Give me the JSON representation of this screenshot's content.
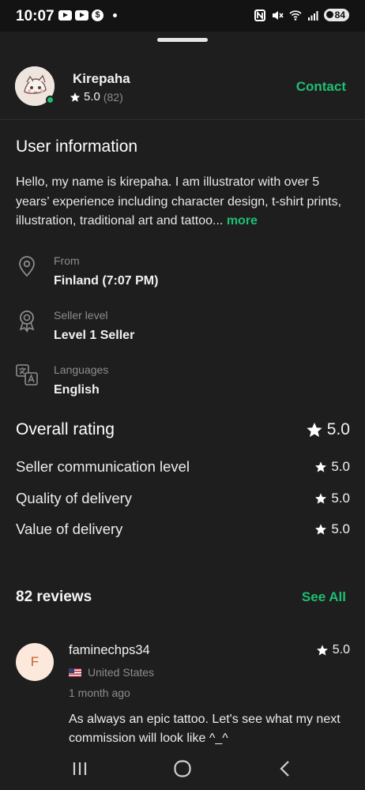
{
  "status_bar": {
    "time": "10:07",
    "left_icons": [
      "youtube-icon",
      "youtube-icon",
      "dollar-icon",
      "dot-icon"
    ],
    "right_icons": [
      "nfc-icon",
      "mute-icon",
      "wifi-icon",
      "signal-icon",
      "battery-icon"
    ],
    "battery": "84"
  },
  "seller": {
    "name": "Kirepaha",
    "rating": "5.0",
    "rating_count": "(82)",
    "contact_label": "Contact",
    "online": true
  },
  "user_info": {
    "title": "User information",
    "about": "Hello, my name is kirepaha. I am illustrator with over 5 years’ experience including character design, t-shirt prints, illustration, traditional art and tattoo...",
    "more_label": "more",
    "details": [
      {
        "icon": "location-pin-icon",
        "label": "From",
        "value": "Finland (7:07 PM)"
      },
      {
        "icon": "award-badge-icon",
        "label": "Seller level",
        "value": "Level 1 Seller"
      },
      {
        "icon": "translate-icon",
        "label": "Languages",
        "value": "English"
      }
    ]
  },
  "ratings": {
    "overall_label": "Overall rating",
    "overall_value": "5.0",
    "items": [
      {
        "label": "Seller communication level",
        "value": "5.0"
      },
      {
        "label": "Quality of delivery",
        "value": "5.0"
      },
      {
        "label": "Value of delivery",
        "value": "5.0"
      }
    ]
  },
  "reviews": {
    "title": "82 reviews",
    "see_all_label": "See All",
    "items": [
      {
        "avatar_letter": "F",
        "name": "faminechps34",
        "rating": "5.0",
        "country": "United States",
        "time": "1 month ago",
        "text": "As always an epic tattoo. Let's see what my next commission will look like ^_^"
      }
    ]
  },
  "colors": {
    "accent": "#1dbf73",
    "background": "#1e1e1e",
    "muted_text": "#8d8d8d"
  }
}
